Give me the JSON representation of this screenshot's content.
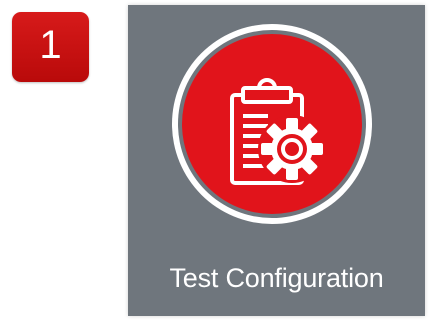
{
  "step": {
    "number": "1",
    "color": "#c81212"
  },
  "tile": {
    "label": "Test Configuration",
    "icon": "clipboard-gear-icon",
    "background": "#6f767d",
    "circle_color": "#e1141b"
  }
}
